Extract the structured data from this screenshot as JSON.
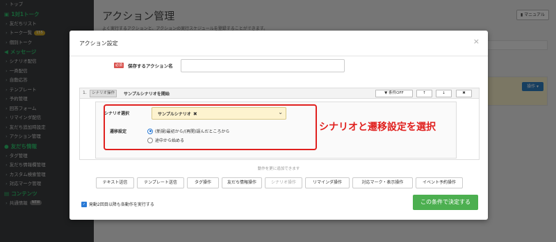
{
  "sidebar": {
    "items": [
      {
        "kind": "item",
        "label": "トップ"
      },
      {
        "kind": "section",
        "label": "1対1トーク",
        "icon": "chat-icon"
      },
      {
        "kind": "item",
        "label": "友だちリスト"
      },
      {
        "kind": "item",
        "label": "トーク一覧",
        "badge": "155"
      },
      {
        "kind": "item",
        "label": "個別トーク"
      },
      {
        "kind": "section",
        "label": "メッセージ",
        "icon": "megaphone-icon"
      },
      {
        "kind": "item",
        "label": "シナリオ配信"
      },
      {
        "kind": "item",
        "label": "一斉配信"
      },
      {
        "kind": "item",
        "label": "自動応答"
      },
      {
        "kind": "item",
        "label": "テンプレート"
      },
      {
        "kind": "item",
        "label": "予約管理"
      },
      {
        "kind": "item",
        "label": "回答フォーム"
      },
      {
        "kind": "item",
        "label": "リマインダ配信"
      },
      {
        "kind": "item",
        "label": "友だち追加時設定"
      },
      {
        "kind": "item",
        "label": "アクション管理"
      },
      {
        "kind": "section",
        "label": "友だち情報",
        "icon": "user-icon"
      },
      {
        "kind": "item",
        "label": "タグ管理"
      },
      {
        "kind": "item",
        "label": "友だち情報欄管理"
      },
      {
        "kind": "item",
        "label": "カスタム検索管理"
      },
      {
        "kind": "item",
        "label": "対応マーク管理"
      },
      {
        "kind": "section",
        "label": "コンテンツ",
        "icon": "folder-icon"
      },
      {
        "kind": "item",
        "label": "共通情報",
        "badge": "NEW",
        "badge_style": "gray"
      }
    ]
  },
  "page": {
    "title": "アクション管理",
    "description": "よく実行するアクションと、アクションの実行スケジュールを登録することができます。",
    "manual_label": "マニュアル",
    "operation_label": "操作 ▾"
  },
  "modal": {
    "title": "アクション設定",
    "close_glyph": "×",
    "name_required_badge": "必須",
    "name_label": "保存するアクション名",
    "name_value": "",
    "action": {
      "number": "1.",
      "type_tag": "シナリオ操作",
      "title": "サンプルシナリオを開始",
      "buttons": [
        "条件OFF",
        "↑",
        "↓",
        "✖"
      ]
    },
    "scenario_label": "シナリオ選択",
    "scenario_value": "サンプルシナリオ",
    "scenario_clear": "✖",
    "transition_label": "遷移設定",
    "transition_options": [
      {
        "label": "(新規)最初から/(再開)誤んだところから",
        "checked": true
      },
      {
        "label": "途中から始める",
        "checked": false
      }
    ],
    "add_hint": "動作を更に追加できます",
    "add_buttons": [
      "テキスト送信",
      "テンプレート送信",
      "タグ操作",
      "友だち情報操作",
      "シナリオ操作",
      "リマインダ操作",
      "対応マーク・表示操作",
      "イベント予約操作"
    ],
    "repeat_checkbox_label": "発動2回目以降も各動作を実行する",
    "repeat_checked": true,
    "submit_label": "この条件で決定する"
  },
  "annotation": {
    "text": "シナリオと遷移設定を選択",
    "color": "#e0201e"
  },
  "colors": {
    "sidebar_bg": "#3b3d3f",
    "sidebar_section": "#2ec16c",
    "submit": "#4caf50",
    "select_bg": "#fdf3cf",
    "radio_accent": "#2a7ad6"
  }
}
